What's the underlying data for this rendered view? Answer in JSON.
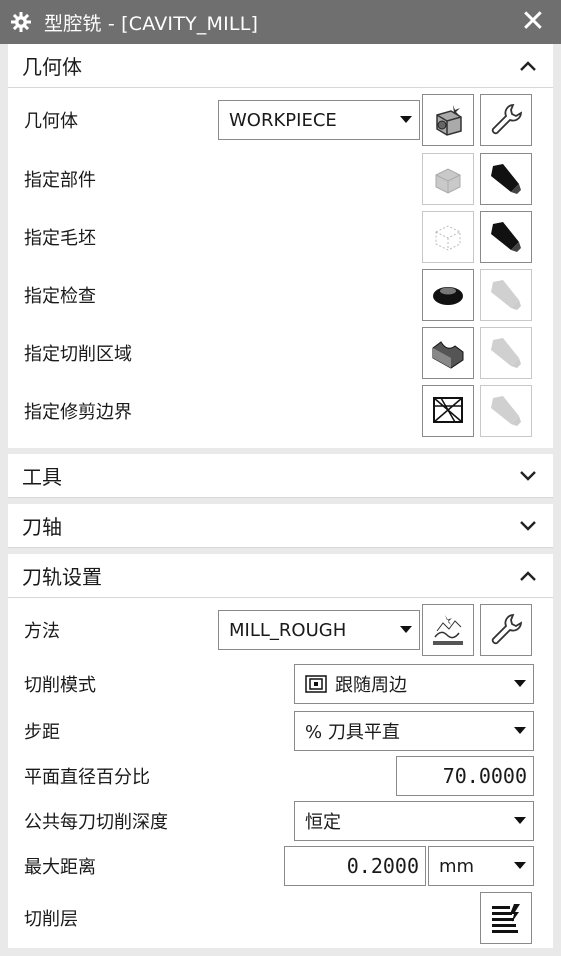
{
  "window": {
    "title": "型腔铣 - [CAVITY_MILL]"
  },
  "geometry": {
    "header": "几何体",
    "geometry_label": "几何体",
    "geometry_value": "WORKPIECE",
    "rows": [
      {
        "label": "指定部件"
      },
      {
        "label": "指定毛坯"
      },
      {
        "label": "指定检查"
      },
      {
        "label": "指定切削区域"
      },
      {
        "label": "指定修剪边界"
      }
    ]
  },
  "tool": {
    "header": "工具"
  },
  "axis": {
    "header": "刀轴"
  },
  "path": {
    "header": "刀轨设置",
    "method_label": "方法",
    "method_value": "MILL_ROUGH",
    "cut_pattern_label": "切削模式",
    "cut_pattern_value": "跟随周边",
    "stepover_label": "步距",
    "stepover_value": "% 刀具平直",
    "percent_label": "平面直径百分比",
    "percent_value": "70.0000",
    "depth_label": "公共每刀切削深度",
    "depth_value": "恒定",
    "maxdist_label": "最大距离",
    "maxdist_value": "0.2000",
    "maxdist_unit": "mm",
    "cutlevels_label": "切削层"
  }
}
